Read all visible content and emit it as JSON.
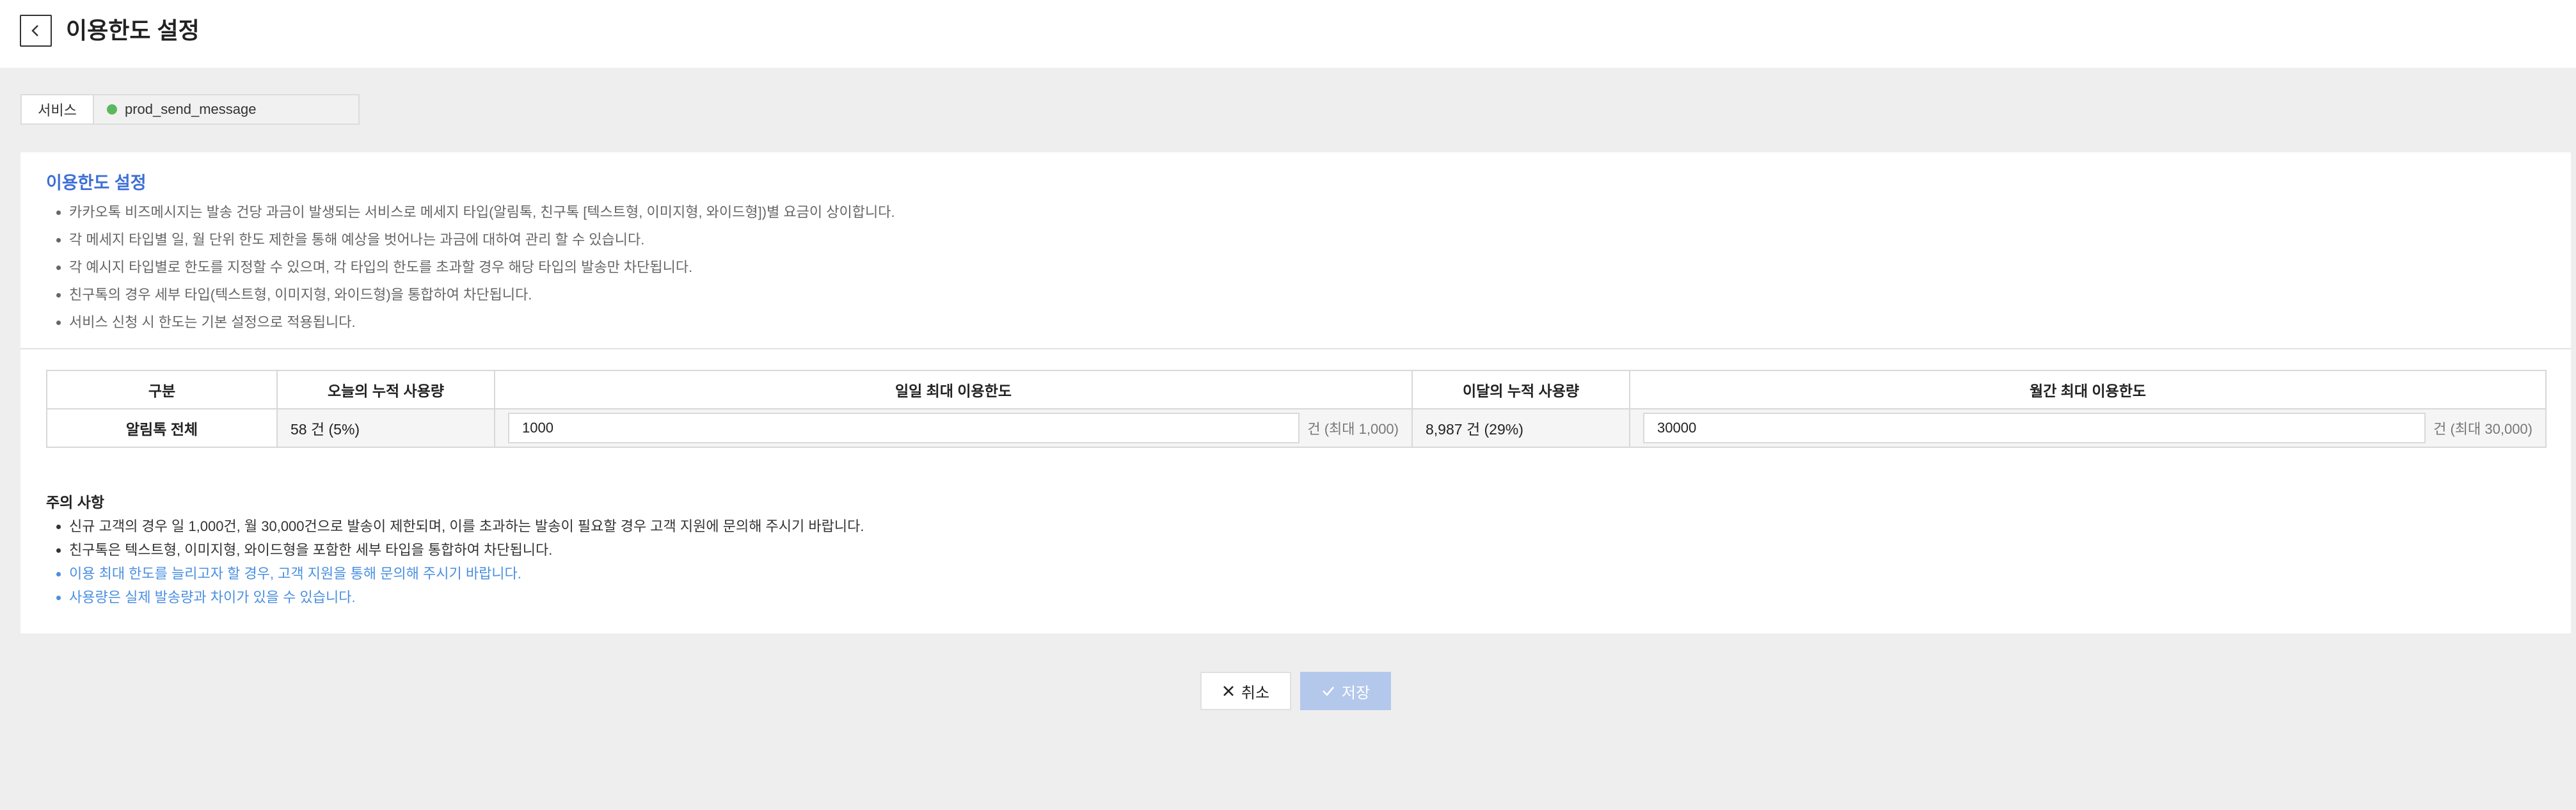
{
  "header": {
    "title": "이용한도 설정",
    "back_icon": "chevron-left-icon"
  },
  "service": {
    "label": "서비스",
    "value": "prod_send_message",
    "status_color": "#5cb85c"
  },
  "info": {
    "title": "이용한도 설정",
    "items": [
      "카카오톡 비즈메시지는 발송 건당 과금이 발생되는 서비스로 메세지 타입(알림톡, 친구톡 [텍스트형, 이미지형, 와이드형])별 요금이 상이합니다.",
      "각 메세지 타입별 일, 월 단위 한도 제한을 통해 예상을 벗어나는 과금에 대하여 관리 할 수 있습니다.",
      "각 예시지 타입별로 한도를 지정할 수 있으며, 각 타입의 한도를 초과할 경우 해당 타입의 발송만 차단됩니다.",
      "친구톡의 경우 세부 타입(텍스트형, 이미지형, 와이드형)을 통합하여 차단됩니다.",
      "서비스 신청 시 한도는 기본 설정으로 적용됩니다."
    ]
  },
  "table": {
    "headers": [
      "구분",
      "오늘의 누적 사용량",
      "일일 최대 이용한도",
      "이달의 누적 사용량",
      "월간 최대 이용한도"
    ],
    "row": {
      "category": "알림톡 전체",
      "today_usage": "58 건 (5%)",
      "daily_limit": "1000",
      "daily_suffix": "건 (최대 1,000)",
      "month_usage": "8,987 건 (29%)",
      "monthly_limit": "30000",
      "monthly_suffix": "건 (최대 30,000)"
    }
  },
  "notes": {
    "title": "주의 사항",
    "items": [
      "신규 고객의 경우 일 1,000건, 월 30,000건으로 발송이 제한되며, 이를 초과하는 발송이 필요할 경우 고객 지원에 문의해 주시기 바랍니다.",
      "친구톡은 텍스트형, 이미지형, 와이드형을 포함한 세부 타입을 통합하여 차단됩니다.",
      "이용 최대 한도를 늘리고자 할 경우, 고객 지원을 통해 문의해 주시기 바랍니다.",
      "사용량은 실제 발송량과 차이가 있을 수 있습니다."
    ],
    "highlight_color": "#4a8fe0"
  },
  "actions": {
    "cancel_label": "취소",
    "cancel_icon": "close-icon",
    "save_label": "저장",
    "save_icon": "check-icon",
    "save_color": "#b4c8ec"
  }
}
